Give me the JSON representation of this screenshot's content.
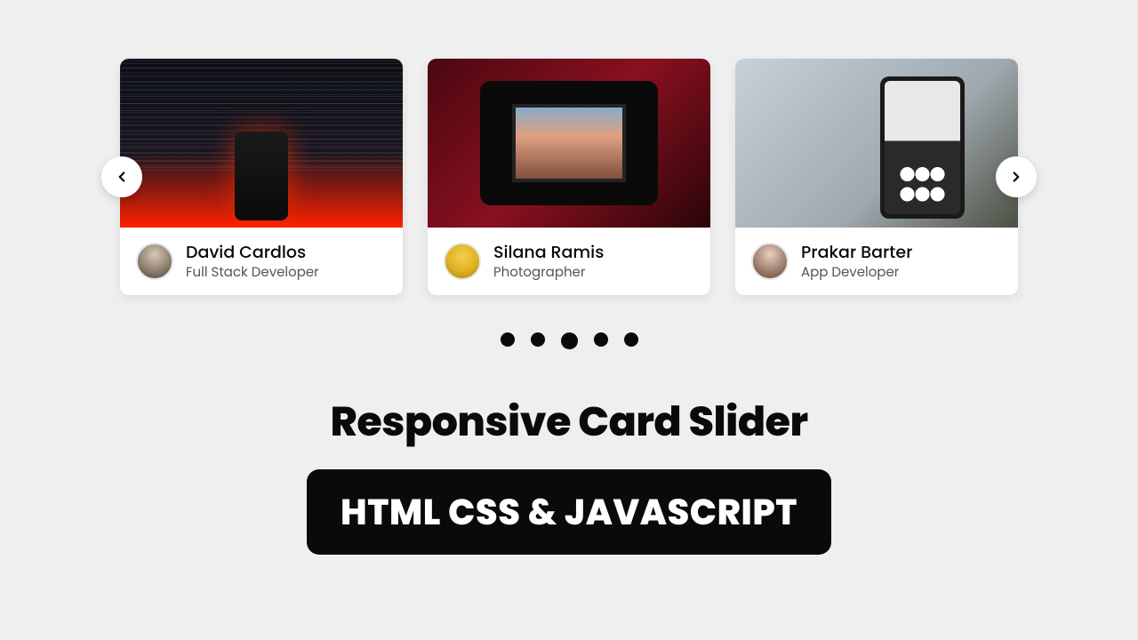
{
  "cards": [
    {
      "name": "David Cardlos",
      "role": "Full Stack Developer"
    },
    {
      "name": "Silana Ramis",
      "role": "Photographer"
    },
    {
      "name": "Prakar Barter",
      "role": "App Developer"
    }
  ],
  "title": "Responsive Card Slider",
  "subtitle": "HTML CSS & JAVASCRIPT",
  "pagination": {
    "dot_count": 5,
    "active_index": 2
  }
}
